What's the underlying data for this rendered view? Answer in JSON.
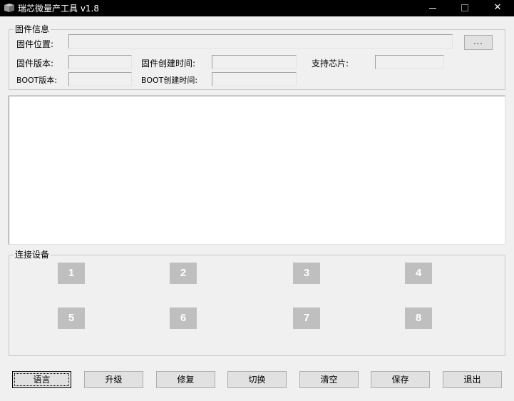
{
  "window": {
    "title": "瑞芯微量产工具 v1.8",
    "minimize": "—",
    "close": "✕"
  },
  "firmware_info": {
    "legend": "固件信息",
    "location_label": "固件位置:",
    "location_value": "",
    "browse_label": "...",
    "version_label": "固件版本:",
    "version_value": "",
    "create_time_label": "固件创建时间:",
    "create_time_value": "",
    "support_chip_label": "支持芯片:",
    "support_chip_value": "",
    "boot_version_label": "BOOT版本:",
    "boot_version_value": "",
    "boot_create_time_label": "BOOT创建时间:",
    "boot_create_time_value": ""
  },
  "log": {
    "text": ""
  },
  "devices": {
    "legend": "连接设备",
    "slots": [
      "1",
      "2",
      "3",
      "4",
      "5",
      "6",
      "7",
      "8"
    ]
  },
  "buttons": {
    "language": "语言",
    "upgrade": "升级",
    "repair": "修复",
    "switch": "切换",
    "clear": "清空",
    "save": "保存",
    "exit": "退出"
  },
  "icons": {
    "app": "app-logo-icon"
  },
  "colors": {
    "titlebar": "#000000",
    "device_slot": "#bfbfbf",
    "window_bg": "#f0f0f0"
  }
}
